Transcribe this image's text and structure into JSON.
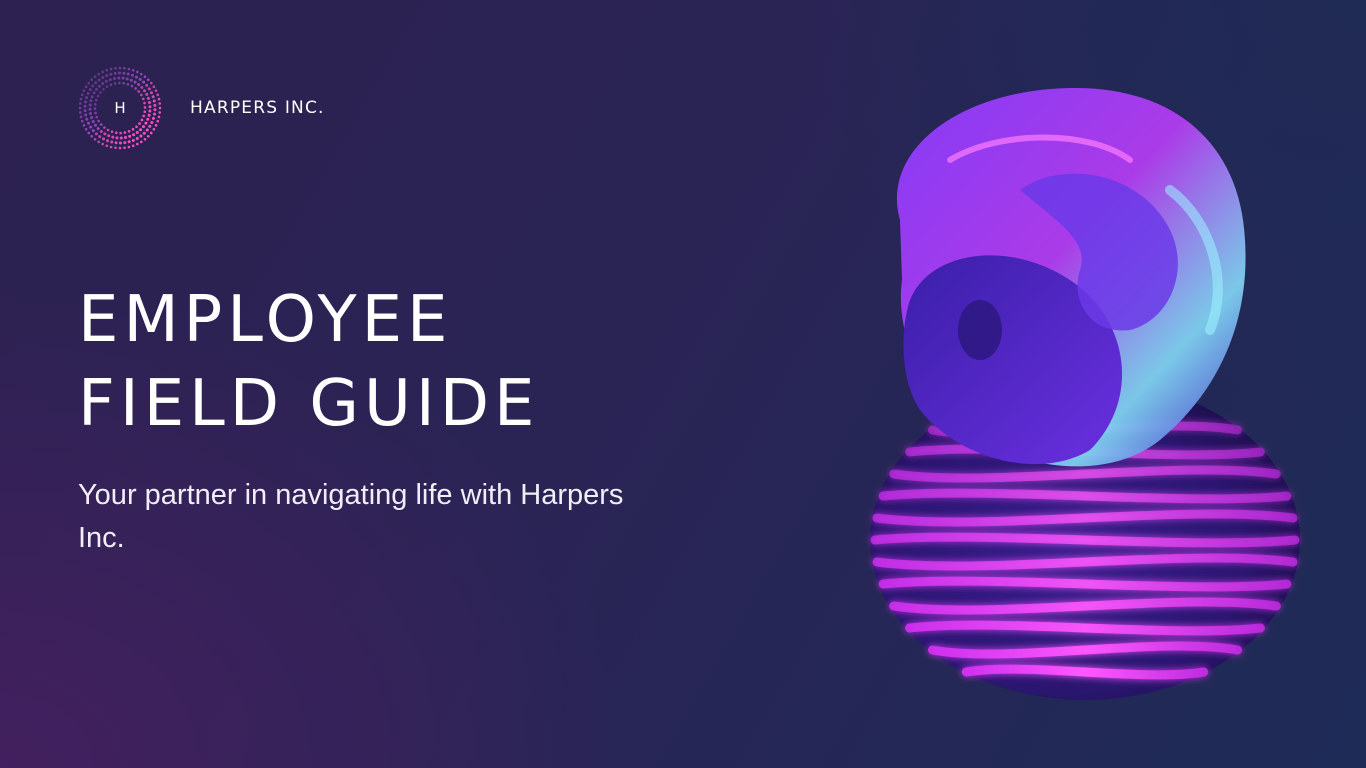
{
  "brand": {
    "logo_letter": "H",
    "name": "HARPERS INC."
  },
  "title": {
    "line1": "EMPLOYEE",
    "line2": "FIELD GUIDE"
  },
  "subtitle": "Your partner in navigating life with Harpers Inc.",
  "colors": {
    "background_start": "#2c2150",
    "background_end": "#1e2b57",
    "accent_magenta": "#e040fb",
    "accent_violet": "#7c3aed",
    "accent_cyan": "#5ee7f0",
    "text": "#ffffff"
  },
  "icons": {
    "logo": "dotted-circle-h-logo",
    "artwork": "abstract-3d-sculpture"
  }
}
